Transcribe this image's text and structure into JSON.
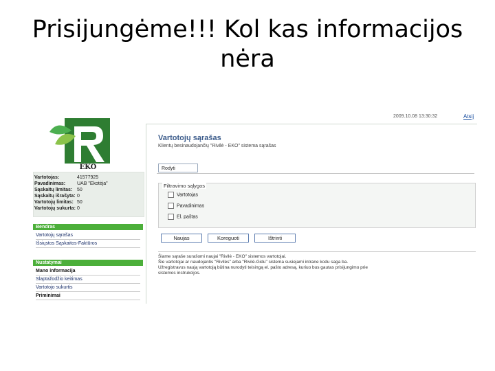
{
  "slide": {
    "title_line1": "Prisijungėme!!! Kol kas informacijos",
    "title_line2": "nėra"
  },
  "app": {
    "timestamp": "2009.10.08 13:30:32",
    "top_link": "Atsij",
    "logo_text": "EKO",
    "user_info": [
      {
        "key": "Vartotojas:",
        "value": "41577925"
      },
      {
        "key": "Pavadinimas:",
        "value": "UAB \"Ekotėja\""
      },
      {
        "key": "Sąskaitų limitas:",
        "value": "50"
      },
      {
        "key": "Sąskaitų išrašyta:",
        "value": "0"
      },
      {
        "key": "Vartotojų limitas:",
        "value": "50"
      },
      {
        "key": "Vartotojų sukurta:",
        "value": "0"
      }
    ],
    "menu_general": {
      "header": "Bendras",
      "items": [
        "Vartotojų sąrašas",
        "Išsiųstos Sąskaitos-Faktūros"
      ]
    },
    "menu_settings": {
      "header": "Nustatymai",
      "items": [
        "Mano informacija",
        "Slaptažodžio keitimas",
        "Vartotojo sukurtis",
        "Priminimai"
      ]
    },
    "content": {
      "title": "Vartotojų sąrašas",
      "subtitle": "Klientų besinaudojančių \"Rivilė - EKO\" sistema sąrašas",
      "edit_button": "Rodyti",
      "filter_legend": "Filtravimo sąlygos",
      "filter_options": [
        "Vartotojas",
        "Pavadinimas",
        "El. paštas"
      ],
      "buttons": {
        "new": "Naujas",
        "edit": "Koreguoti",
        "delete": "Ištrinti"
      },
      "notice_lines": [
        "Šiame sąraše surašomi naujai \"Rivilė - EKO\" sistemos vartotojai.",
        "Šie vartotojai ar naudojantis \"Rivilės\" arba \"Rivilė-Gidu\" sistema susiejami intrane kodu saga ba.",
        "Užregistravus naują vartotoją būtina nurodyti teisingą el. pašto adresą, kuriuo bus gautas prisijungimo prie",
        "sistemos instrukcijos."
      ]
    }
  },
  "colors": {
    "menu_header": "#4caf3a",
    "title_blue": "#3a5a8a",
    "link": "#1a4fa0"
  }
}
